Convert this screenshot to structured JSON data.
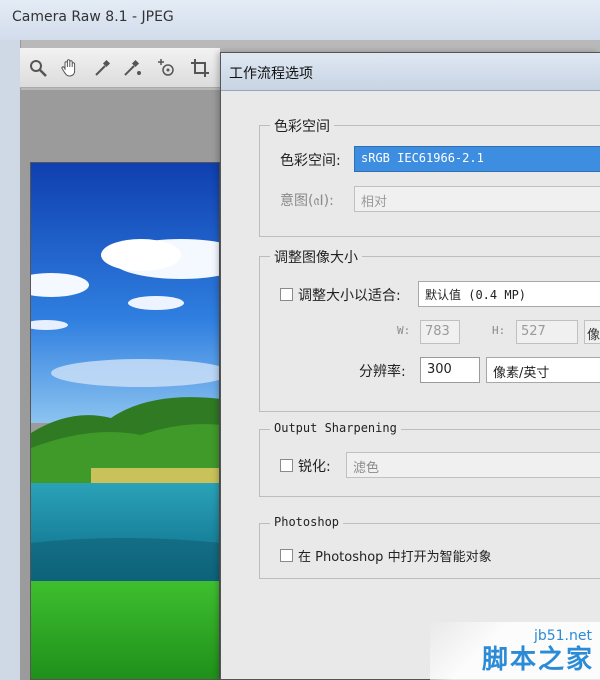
{
  "app": {
    "title": "Camera Raw 8.1 -  JPEG"
  },
  "toolbar": {
    "tools": [
      "zoom-icon",
      "hand-icon",
      "white-balance-icon",
      "color-sampler-icon",
      "target-adjust-icon",
      "crop-icon"
    ]
  },
  "dialog": {
    "title": "工作流程选项",
    "color_space": {
      "legend": "色彩空间",
      "space_label": "色彩空间:",
      "space_value": "sRGB IEC61966-2.1",
      "intent_label": "意图(𝔞I):",
      "intent_value": "相对"
    },
    "resize": {
      "legend": "调整图像大小",
      "fit_label": "调整大小以适合:",
      "fit_value": "默认值 (0.4 MP)",
      "w_label": "W:",
      "w_value": "783",
      "h_label": "H:",
      "h_value": "527",
      "unit_partial": "像",
      "resolution_label": "分辨率:",
      "resolution_value": "300",
      "resolution_unit": "像素/英寸"
    },
    "sharpen": {
      "legend": "Output Sharpening",
      "label": "锐化:",
      "value": "滤色"
    },
    "photoshop": {
      "legend": "Photoshop",
      "smart_object_label": "在 Photoshop 中打开为智能对象"
    }
  },
  "watermark": {
    "line1": "jb51.net",
    "line2": "脚本之家"
  }
}
